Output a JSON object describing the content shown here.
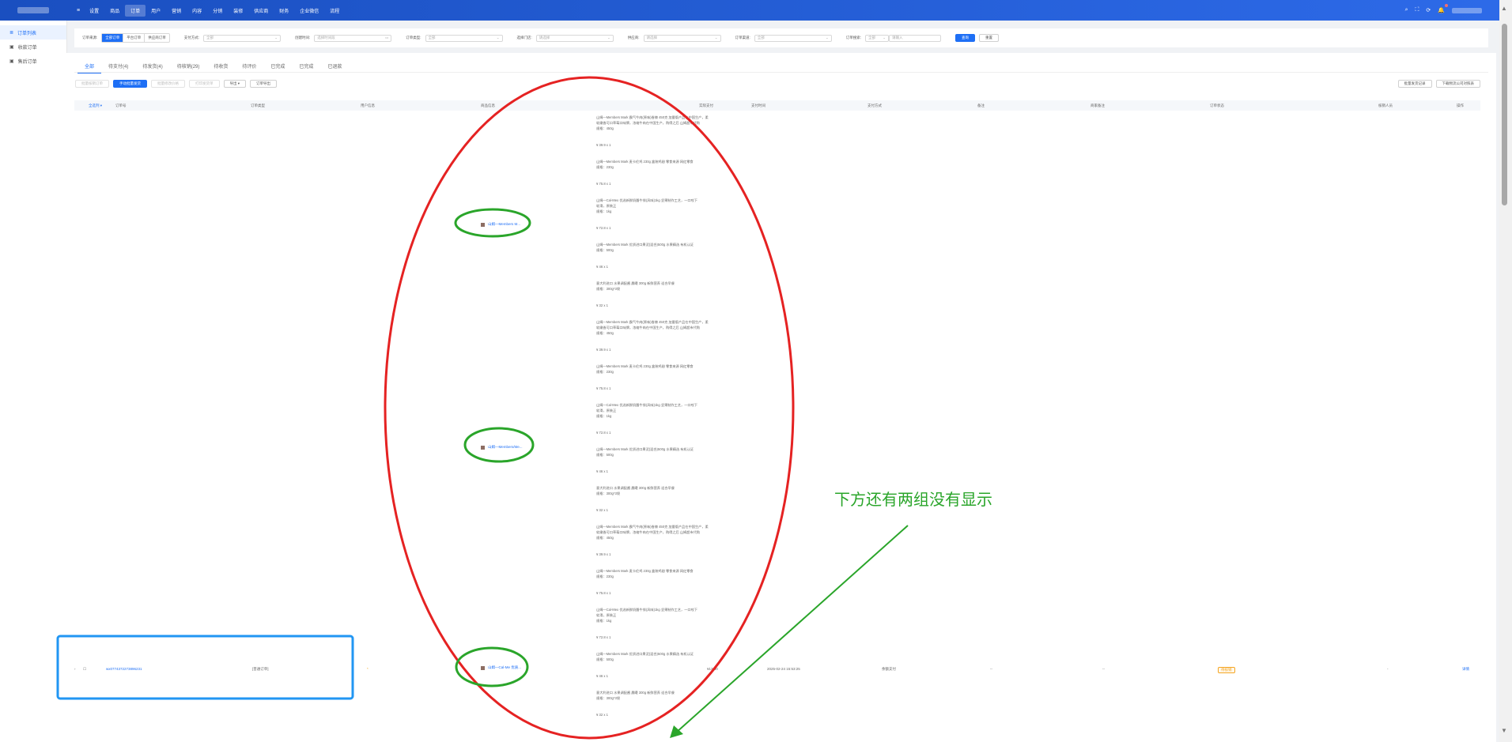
{
  "topbar": {
    "menu": [
      "≡",
      "设置",
      "商品",
      "订单",
      "用户",
      "营销",
      "内容",
      "分销",
      "装修",
      "供应商",
      "财务",
      "企业微信",
      "流程"
    ],
    "active_index": 3
  },
  "sidebar": {
    "items": [
      {
        "label": "订单列表",
        "icon": "list-icon"
      },
      {
        "label": "收款订单",
        "icon": "money-icon"
      },
      {
        "label": "售后订单",
        "icon": "aftersale-icon"
      }
    ]
  },
  "filters": {
    "order_source_label": "订单来源:",
    "order_source_options": [
      "全部订单",
      "平台订单",
      "供应商订单"
    ],
    "pay_method_label": "支付方式:",
    "pay_method_placeholder": "全部",
    "time_label": "创建时间:",
    "time_placeholder": "选择时间段",
    "order_type_label": "订单类型:",
    "order_type_placeholder": "全部",
    "store_label": "选择门店:",
    "store_placeholder": "请选择",
    "supplier_label": "供应商:",
    "supplier_placeholder": "请选择",
    "channel_label": "订单渠道:",
    "channel_placeholder": "全部",
    "search_label": "订单搜索:",
    "search_type": "全部",
    "search_placeholder": "请输入",
    "query_button": "查询",
    "reset_button": "重置"
  },
  "tabs": [
    "全部",
    "待支付(4)",
    "待发货(4)",
    "待核销(29)",
    "待收货",
    "待评价",
    "已完成",
    "已完成",
    "已退款"
  ],
  "actions_left": [
    "批量核销订单",
    "手动批量发货",
    "批量修改价格",
    "打印发货单",
    "导出 ▾",
    "订单导出"
  ],
  "actions_right": [
    "批量发货记录",
    "下载物流公司对照表"
  ],
  "table_headers": [
    "全选列 ▾",
    "订单号",
    "订单类型",
    "用户信息",
    "商品信息",
    "实际支付",
    "支付时间",
    "支付方式",
    "备注",
    "商家备注",
    "订单状态",
    "核销人员",
    "操作"
  ],
  "product_lines": [
    "山姆—Members Mark 霸气牛肉(原味)香辣 450克 加量版产品在中国生产，柔",
    "软嫩香可口草莓口味牌，浓缩牛肉在中国生产，购得之后 山姆超市代购",
    "规格：450g",
    "¥ 39.9 x 1",
    "山姆—Members Mark 麦卡伦鸡 230g 盒装鸡翅 零食来源 网红零食",
    "规格：230g",
    "¥ 75.8 x 1",
    "山姆—Cal-Mex 优选新鲜奶酪牛排(风味)1kg 坚果制作工艺，一口咬下",
    "软滑，原装正",
    "规格：1kg",
    "¥ 72.8 x 1",
    "山姆—Members Mark 优质进口果泥(混合)500g 水果精选 有机认证",
    "规格：500g",
    "¥ 46 x 1",
    "意大利进口 水果调配酱 晨曦 300g 新鲜营养 适合早餐",
    "规格：300g*3袋",
    "¥ 32 x 1"
  ],
  "thumbs": [
    "山姆—Members M...",
    "山姆—Members/Me...",
    "山姆—Cal-Me 优质..."
  ],
  "row": {
    "order_no": "wx0774372273896231",
    "order_type": "[普通订单]",
    "user": "*",
    "paid": "¥13.40",
    "pay_time": "2025-02-24 15:53:25",
    "pay_method": "余额支付",
    "remark": "--",
    "merchant_remark": "--",
    "status": "待核销",
    "verifier": "-",
    "op": "详情"
  },
  "annotation": {
    "text": "下方还有两组没有显示",
    "color": "#2aa52a"
  }
}
